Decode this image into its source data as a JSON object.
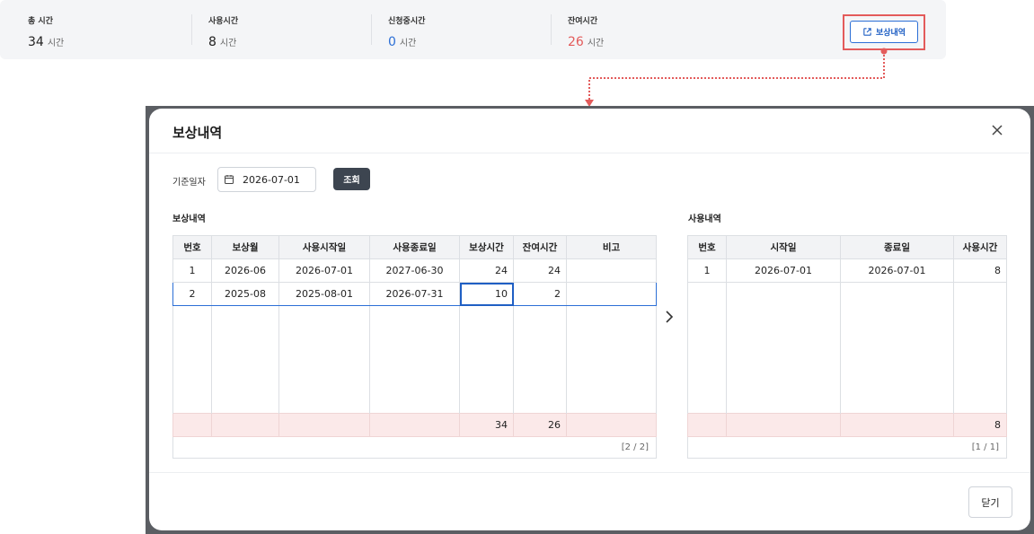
{
  "summary": {
    "items": [
      {
        "label": "총 시간",
        "value": "34",
        "unit": "시간",
        "color": "#222222"
      },
      {
        "label": "사용시간",
        "value": "8",
        "unit": "시간",
        "color": "#222222"
      },
      {
        "label": "신청중시간",
        "value": "0",
        "unit": "시간",
        "color": "#2c6fd6"
      },
      {
        "label": "잔여시간",
        "value": "26",
        "unit": "시간",
        "color": "#e35b5b"
      }
    ],
    "button_label": "보상내역",
    "button_icon": "external-link-icon"
  },
  "modal": {
    "title": "보상내역",
    "close_icon": "close-icon",
    "date_label": "기준일자",
    "date_value": "2026-07-01",
    "date_icon": "calendar-icon",
    "search_label": "조회",
    "close_button_label": "닫기",
    "nav_icon": "chevron-right-icon"
  },
  "compensation": {
    "title": "보상내역",
    "headers": [
      "번호",
      "보상월",
      "사용시작일",
      "사용종료일",
      "보상시간",
      "잔여시간",
      "비고"
    ],
    "rows": [
      [
        "1",
        "2026-06",
        "2026-07-01",
        "2027-06-30",
        "24",
        "24",
        ""
      ],
      [
        "2",
        "2025-08",
        "2025-08-01",
        "2026-07-31",
        "10",
        "2",
        ""
      ]
    ],
    "totals": [
      "",
      "",
      "",
      "",
      "34",
      "26",
      ""
    ],
    "pager": "[2 / 2]"
  },
  "usage": {
    "title": "사용내역",
    "headers": [
      "번호",
      "시작일",
      "종료일",
      "사용시간"
    ],
    "rows": [
      [
        "1",
        "2026-07-01",
        "2026-07-01",
        "8"
      ]
    ],
    "totals": [
      "",
      "",
      "",
      "8"
    ],
    "pager": "[1 / 1]"
  },
  "colors": {
    "accent": "#2c6fd6",
    "highlight": "#e35b5b",
    "total_row": "#fbe9e9",
    "dark_button": "#3d4550"
  }
}
